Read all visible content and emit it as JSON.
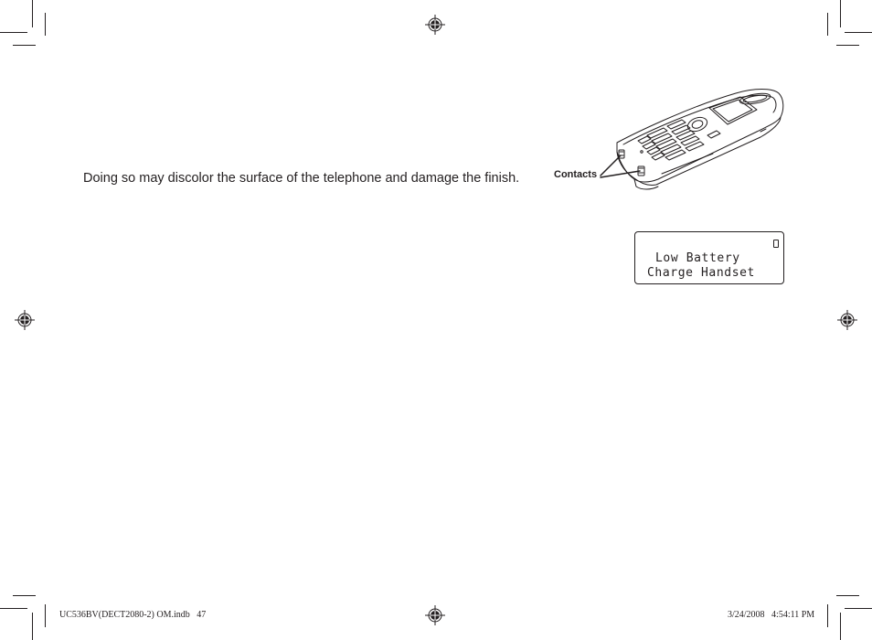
{
  "page": {
    "body_text": "Doing so may discolor the surface of the telephone and damage the finish."
  },
  "figure": {
    "phone_illustration": "handset-icon",
    "contacts_label": "Contacts"
  },
  "lcd_display": {
    "battery_icon": "battery-empty-icon",
    "line1": "Low Battery",
    "line2": "Charge Handset"
  },
  "footer": {
    "file_info": "UC536BV(DECT2080-2) OM.indb   47",
    "timestamp": "3/24/2008   4:54:11 PM"
  },
  "colors": {
    "ink": "#231f20",
    "paper": "#ffffff"
  }
}
